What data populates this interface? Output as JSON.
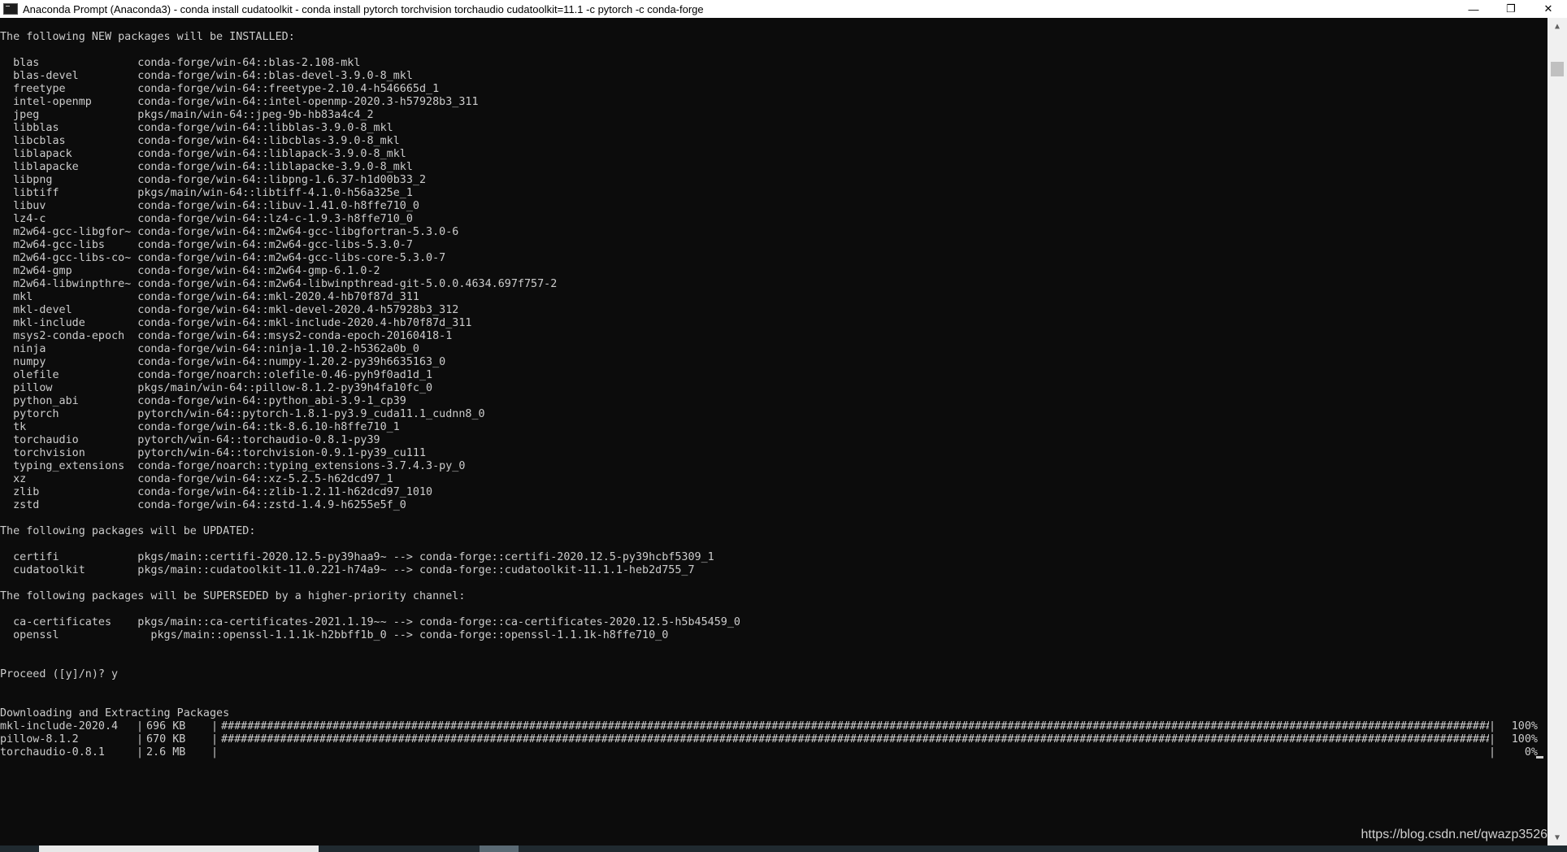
{
  "window": {
    "title": "Anaconda Prompt (Anaconda3) - conda  install cudatoolkit - conda  install pytorch torchvision torchaudio cudatoolkit=11.1 -c pytorch -c conda-forge",
    "minimize_glyph": "—",
    "restore_glyph": "❐",
    "close_glyph": "✕"
  },
  "console": {
    "lines": [
      "",
      "The following NEW packages will be INSTALLED:",
      "",
      "  blas               conda-forge/win-64::blas-2.108-mkl",
      "  blas-devel         conda-forge/win-64::blas-devel-3.9.0-8_mkl",
      "  freetype           conda-forge/win-64::freetype-2.10.4-h546665d_1",
      "  intel-openmp       conda-forge/win-64::intel-openmp-2020.3-h57928b3_311",
      "  jpeg               pkgs/main/win-64::jpeg-9b-hb83a4c4_2",
      "  libblas            conda-forge/win-64::libblas-3.9.0-8_mkl",
      "  libcblas           conda-forge/win-64::libcblas-3.9.0-8_mkl",
      "  liblapack          conda-forge/win-64::liblapack-3.9.0-8_mkl",
      "  liblapacke         conda-forge/win-64::liblapacke-3.9.0-8_mkl",
      "  libpng             conda-forge/win-64::libpng-1.6.37-h1d00b33_2",
      "  libtiff            pkgs/main/win-64::libtiff-4.1.0-h56a325e_1",
      "  libuv              conda-forge/win-64::libuv-1.41.0-h8ffe710_0",
      "  lz4-c              conda-forge/win-64::lz4-c-1.9.3-h8ffe710_0",
      "  m2w64-gcc-libgfor~ conda-forge/win-64::m2w64-gcc-libgfortran-5.3.0-6",
      "  m2w64-gcc-libs     conda-forge/win-64::m2w64-gcc-libs-5.3.0-7",
      "  m2w64-gcc-libs-co~ conda-forge/win-64::m2w64-gcc-libs-core-5.3.0-7",
      "  m2w64-gmp          conda-forge/win-64::m2w64-gmp-6.1.0-2",
      "  m2w64-libwinpthre~ conda-forge/win-64::m2w64-libwinpthread-git-5.0.0.4634.697f757-2",
      "  mkl                conda-forge/win-64::mkl-2020.4-hb70f87d_311",
      "  mkl-devel          conda-forge/win-64::mkl-devel-2020.4-h57928b3_312",
      "  mkl-include        conda-forge/win-64::mkl-include-2020.4-hb70f87d_311",
      "  msys2-conda-epoch  conda-forge/win-64::msys2-conda-epoch-20160418-1",
      "  ninja              conda-forge/win-64::ninja-1.10.2-h5362a0b_0",
      "  numpy              conda-forge/win-64::numpy-1.20.2-py39h6635163_0",
      "  olefile            conda-forge/noarch::olefile-0.46-pyh9f0ad1d_1",
      "  pillow             pkgs/main/win-64::pillow-8.1.2-py39h4fa10fc_0",
      "  python_abi         conda-forge/win-64::python_abi-3.9-1_cp39",
      "  pytorch            pytorch/win-64::pytorch-1.8.1-py3.9_cuda11.1_cudnn8_0",
      "  tk                 conda-forge/win-64::tk-8.6.10-h8ffe710_1",
      "  torchaudio         pytorch/win-64::torchaudio-0.8.1-py39",
      "  torchvision        pytorch/win-64::torchvision-0.9.1-py39_cu111",
      "  typing_extensions  conda-forge/noarch::typing_extensions-3.7.4.3-py_0",
      "  xz                 conda-forge/win-64::xz-5.2.5-h62dcd97_1",
      "  zlib               conda-forge/win-64::zlib-1.2.11-h62dcd97_1010",
      "  zstd               conda-forge/win-64::zstd-1.4.9-h6255e5f_0",
      "",
      "The following packages will be UPDATED:",
      "",
      "  certifi            pkgs/main::certifi-2020.12.5-py39haa9~ --> conda-forge::certifi-2020.12.5-py39hcbf5309_1",
      "  cudatoolkit        pkgs/main::cudatoolkit-11.0.221-h74a9~ --> conda-forge::cudatoolkit-11.1.1-heb2d755_7",
      "",
      "The following packages will be SUPERSEDED by a higher-priority channel:",
      "",
      "  ca-certificates    pkgs/main::ca-certificates-2021.1.19~~ --> conda-forge::ca-certificates-2020.12.5-h5b45459_0",
      "  openssl              pkgs/main::openssl-1.1.1k-h2bbff1b_0 --> conda-forge::openssl-1.1.1k-h8ffe710_0",
      "",
      "",
      "Proceed ([y]/n)? y",
      "",
      "",
      "Downloading and Extracting Packages"
    ],
    "downloads": [
      {
        "name": "mkl-include-2020.4",
        "size": "696 KB",
        "progress": "#########################################################################################################################################################################################################",
        "percent": "100%"
      },
      {
        "name": "pillow-8.1.2",
        "size": "670 KB",
        "progress": "#########################################################################################################################################################################################################",
        "percent": "100%"
      },
      {
        "name": "torchaudio-0.8.1",
        "size": "2.6 MB",
        "progress": "",
        "percent": "0%"
      }
    ],
    "separator": "|"
  },
  "watermark": "https://blog.csdn.net/qwazp3526"
}
